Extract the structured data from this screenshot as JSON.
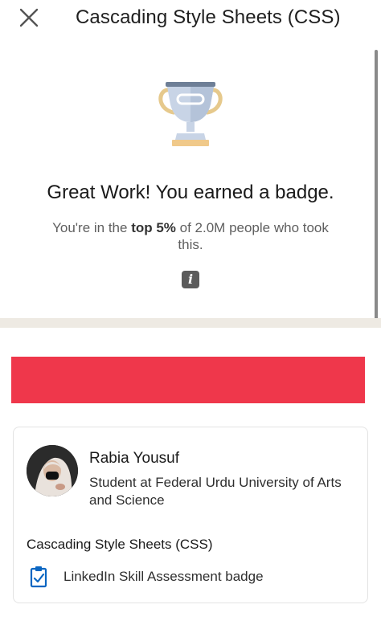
{
  "header": {
    "title": "Cascading Style Sheets (CSS)",
    "close_icon": "close-icon"
  },
  "result": {
    "trophy_icon": "trophy-icon",
    "headline": "Great Work! You earned a badge.",
    "subtext_prefix": "You're in the ",
    "subtext_bold": "top 5%",
    "subtext_suffix": " of 2.0M people who took this.",
    "info_icon": "info-icon",
    "info_glyph": "i"
  },
  "colors": {
    "banner": "#ef374b",
    "divider": "#eeeae3",
    "badge_icon": "#0a66c2",
    "trophy_cup": "#c8d4e6",
    "trophy_handles": "#e6c98c"
  },
  "profile_card": {
    "name": "Rabia Yousuf",
    "headline": "Student at Federal Urdu University of Arts and Science",
    "skill": "Cascading Style Sheets (CSS)",
    "badge_label": "LinkedIn Skill Assessment badge",
    "badge_icon": "clipboard-check-icon",
    "avatar_icon": "avatar"
  }
}
